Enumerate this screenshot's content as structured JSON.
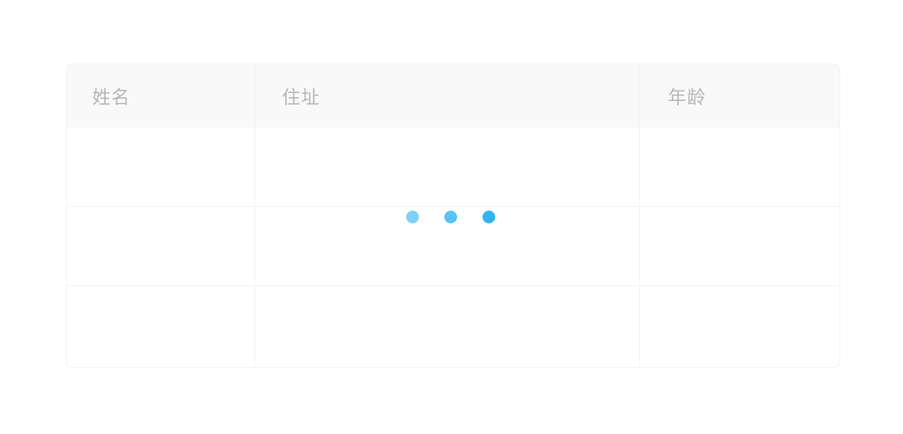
{
  "table": {
    "columns": [
      {
        "label": "姓名"
      },
      {
        "label": "住址"
      },
      {
        "label": "年龄"
      }
    ],
    "row_count": 3,
    "state": "loading"
  },
  "loading_indicator": {
    "dot_colors": [
      "#7fd0f6",
      "#5ac3f3",
      "#32b4ef"
    ]
  }
}
